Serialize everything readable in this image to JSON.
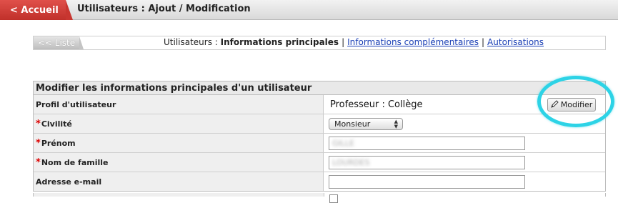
{
  "header": {
    "home_label": "< Accueil",
    "title": "Utilisateurs : Ajout / Modification"
  },
  "nav": {
    "back_label": "<< Liste",
    "prefix": "Utilisateurs : ",
    "current": "Informations principales",
    "sep": "|",
    "link_complementary": "Informations complémentaires",
    "link_authorizations": "Autorisations"
  },
  "form": {
    "title": "Modifier les informations principales d'un utilisateur",
    "profile": {
      "label": "Profil d'utilisateur",
      "value": "Professeur : Collège",
      "modify_label": "Modifier",
      "modify_icon": "pencil-icon"
    },
    "civility": {
      "required": "*",
      "label": "Civilité",
      "value": "Monsieur"
    },
    "first_name": {
      "required": "*",
      "label": "Prénom",
      "value": "GILLE"
    },
    "last_name": {
      "required": "*",
      "label": "Nom de famille",
      "value": "LOURDES"
    },
    "email": {
      "label": "Adresse e-mail",
      "value": ""
    }
  },
  "colors": {
    "home_button": "#d04740",
    "link": "#1a3fb5",
    "required": "#dd0000",
    "highlight_ring": "#2dd3e6"
  }
}
